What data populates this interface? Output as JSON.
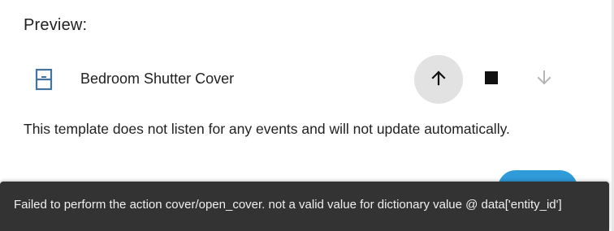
{
  "preview": {
    "label": "Preview:"
  },
  "entity": {
    "name": "Bedroom Shutter Cover",
    "icon": "window-shutter-icon",
    "controls": {
      "open": "arrow-up-icon",
      "stop": "stop-icon",
      "close": "arrow-down-icon"
    }
  },
  "notice": "This template does not listen for any events and will not update automatically.",
  "toast": {
    "message": "Failed to perform the action cover/open_cover. not a valid value for dictionary value @ data['entity_id']"
  },
  "colors": {
    "icon_blue": "#44739e",
    "accent_button": "#2f9bd9",
    "toast_bg": "#333333"
  }
}
